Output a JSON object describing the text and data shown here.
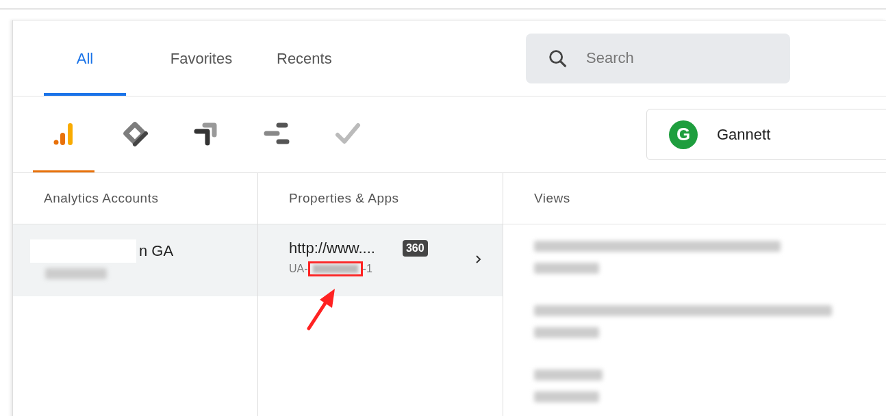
{
  "tabs": [
    {
      "label": "All",
      "selected": true
    },
    {
      "label": "Favorites",
      "selected": false
    },
    {
      "label": "Recents",
      "selected": false
    }
  ],
  "search": {
    "placeholder": "Search"
  },
  "products": [
    {
      "kind": "analytics",
      "selected": true
    },
    {
      "kind": "tagmanager",
      "selected": false
    },
    {
      "kind": "optimize",
      "selected": false
    },
    {
      "kind": "datastudio",
      "selected": false
    },
    {
      "kind": "surveys",
      "selected": false
    }
  ],
  "organization": {
    "initial": "G",
    "name": "Gannett"
  },
  "columns": [
    {
      "heading": "Analytics Accounts"
    },
    {
      "heading": "Properties & Apps"
    },
    {
      "heading": "Views"
    }
  ],
  "account": {
    "name": "n GA",
    "selected": true
  },
  "property": {
    "name": "http://www....",
    "badge": "360",
    "id_prefix": "UA-",
    "id_suffix": "-1",
    "selected": true,
    "highlighted": true
  }
}
